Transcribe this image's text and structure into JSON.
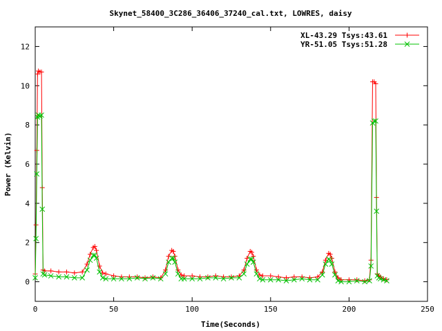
{
  "chart_data": {
    "type": "line",
    "title": "Skynet_58400_3C286_36406_37240_cal.txt, LOWRES, daisy",
    "xlabel": "Time(Seconds)",
    "ylabel": "Power (Kelvin)",
    "xlim": [
      0,
      250
    ],
    "ylim": [
      -1,
      13
    ],
    "x_ticks": [
      0,
      50,
      100,
      150,
      200,
      250
    ],
    "y_ticks": [
      0,
      2,
      4,
      6,
      8,
      10,
      12
    ],
    "grid": false,
    "legend_position": "top-right",
    "series": [
      {
        "name": "XL-43.29 Tsys:43.61",
        "color": "#ff0000",
        "marker": "plus",
        "x": [
          0,
          0.5,
          1,
          1.5,
          2,
          3,
          4,
          4.5,
          5,
          6,
          10,
          15,
          20,
          25,
          30,
          33,
          35,
          37,
          38,
          39,
          41,
          43,
          45,
          50,
          55,
          60,
          65,
          70,
          75,
          80,
          83,
          85,
          87,
          88,
          89,
          91,
          93,
          95,
          100,
          105,
          110,
          115,
          120,
          125,
          130,
          133,
          135,
          137,
          138,
          139,
          141,
          143,
          145,
          150,
          155,
          160,
          165,
          170,
          175,
          180,
          183,
          185,
          187,
          188,
          189,
          191,
          193,
          195,
          200,
          205,
          210,
          213,
          214,
          215,
          216,
          217,
          217.5,
          218,
          219,
          220,
          222,
          224
        ],
        "y": [
          0.4,
          2.9,
          6.7,
          10.6,
          10.75,
          10.7,
          10.7,
          4.8,
          0.6,
          0.55,
          0.55,
          0.5,
          0.5,
          0.45,
          0.5,
          0.9,
          1.4,
          1.75,
          1.8,
          1.6,
          0.8,
          0.45,
          0.4,
          0.3,
          0.25,
          0.25,
          0.25,
          0.2,
          0.25,
          0.2,
          0.6,
          1.3,
          1.6,
          1.55,
          1.3,
          0.6,
          0.35,
          0.3,
          0.3,
          0.25,
          0.25,
          0.3,
          0.25,
          0.25,
          0.3,
          0.6,
          1.2,
          1.55,
          1.5,
          1.3,
          0.6,
          0.35,
          0.3,
          0.3,
          0.25,
          0.2,
          0.25,
          0.25,
          0.2,
          0.25,
          0.5,
          1.1,
          1.45,
          1.4,
          1.2,
          0.5,
          0.2,
          0.1,
          0.1,
          0.1,
          0.05,
          0.1,
          1.1,
          10.2,
          10.2,
          10.1,
          4.3,
          0.4,
          0.3,
          0.25,
          0.15,
          0.1
        ]
      },
      {
        "name": "YR-51.05 Tsys:51.28",
        "color": "#00c000",
        "marker": "cross",
        "x": [
          0,
          0.5,
          1,
          1.5,
          2,
          3,
          4,
          4.5,
          5,
          6,
          10,
          15,
          20,
          25,
          30,
          33,
          35,
          37,
          38,
          39,
          41,
          43,
          45,
          50,
          55,
          60,
          65,
          70,
          75,
          80,
          83,
          85,
          87,
          88,
          89,
          91,
          93,
          95,
          100,
          105,
          110,
          115,
          120,
          125,
          130,
          133,
          135,
          137,
          138,
          139,
          141,
          143,
          145,
          150,
          155,
          160,
          165,
          170,
          175,
          180,
          183,
          185,
          187,
          188,
          189,
          191,
          193,
          195,
          200,
          205,
          210,
          213,
          214,
          215,
          216,
          217,
          217.5,
          218,
          219,
          220,
          222,
          224
        ],
        "y": [
          0.2,
          2.2,
          5.5,
          8.4,
          8.5,
          8.45,
          8.5,
          3.7,
          0.4,
          0.35,
          0.3,
          0.25,
          0.25,
          0.2,
          0.2,
          0.6,
          1.1,
          1.35,
          1.35,
          1.2,
          0.5,
          0.2,
          0.15,
          0.15,
          0.15,
          0.15,
          0.2,
          0.15,
          0.2,
          0.15,
          0.4,
          1.0,
          1.2,
          1.2,
          1.0,
          0.4,
          0.15,
          0.15,
          0.15,
          0.15,
          0.2,
          0.2,
          0.15,
          0.2,
          0.2,
          0.4,
          0.9,
          1.15,
          1.15,
          1.0,
          0.4,
          0.15,
          0.1,
          0.1,
          0.1,
          0.05,
          0.1,
          0.15,
          0.1,
          0.1,
          0.35,
          0.9,
          1.15,
          1.1,
          0.9,
          0.35,
          0.05,
          0.0,
          0.0,
          0.05,
          0.0,
          0.05,
          0.8,
          8.1,
          8.2,
          8.2,
          3.6,
          0.3,
          0.2,
          0.15,
          0.1,
          0.05
        ]
      }
    ]
  }
}
